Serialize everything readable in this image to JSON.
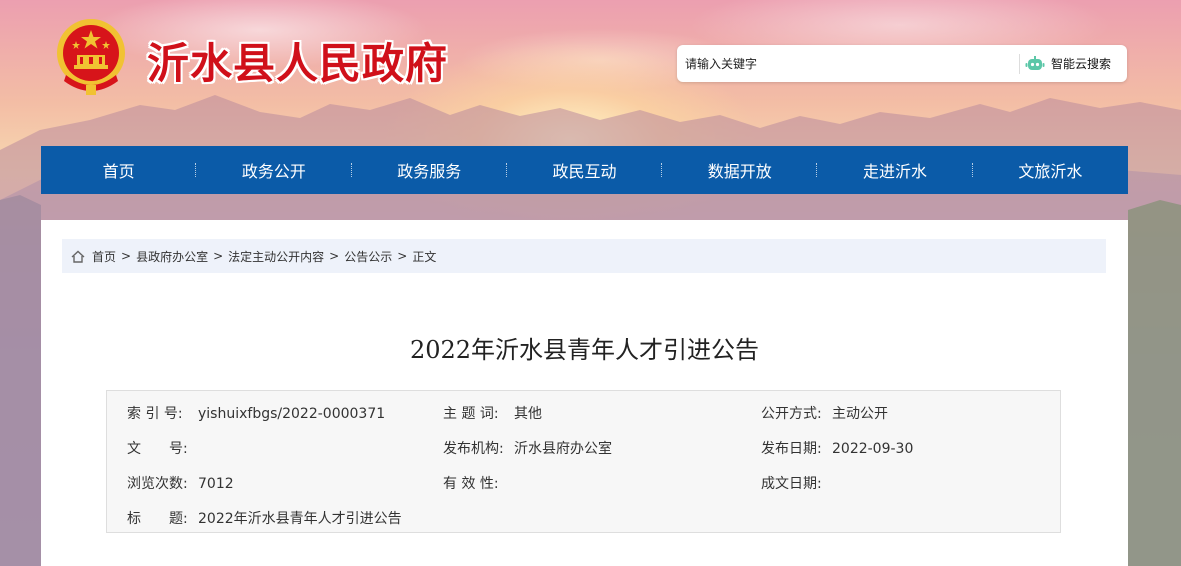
{
  "site": {
    "title": "沂水县人民政府"
  },
  "search": {
    "placeholder": "请输入关键字",
    "button_label": "智能云搜索"
  },
  "nav": {
    "items": [
      "首页",
      "政务公开",
      "政务服务",
      "政民互动",
      "数据开放",
      "走进沂水",
      "文旅沂水"
    ]
  },
  "breadcrumb": {
    "items": [
      "首页",
      "县政府办公室",
      "法定主动公开内容",
      "公告公示"
    ],
    "current": "正文",
    "separator": ">"
  },
  "article": {
    "title": "2022年沂水县青年人才引进公告"
  },
  "info": {
    "index_label": "索 引 号:",
    "index_value": "yishuixfbgs/2022-0000371",
    "topic_label": "主 题 词:",
    "topic_value": "其他",
    "open_mode_label": "公开方式:",
    "open_mode_value": "主动公开",
    "doc_no_label": "文　　号:",
    "doc_no_value": "",
    "issuer_label": "发布机构:",
    "issuer_value": "沂水县府办公室",
    "publish_date_label": "发布日期:",
    "publish_date_value": "2022-09-30",
    "views_label": "浏览次数:",
    "views_value": "7012",
    "validity_label": "有 效 性:",
    "validity_value": "",
    "created_date_label": "成文日期:",
    "created_date_value": "",
    "title_label": "标　　题:",
    "title_value": "2022年沂水县青年人才引进公告"
  },
  "colors": {
    "nav_bg": "#0b5ba8",
    "site_title": "#d0101a",
    "breadcrumb_bg": "#eef2fa",
    "info_bg": "#f7f7f7"
  }
}
